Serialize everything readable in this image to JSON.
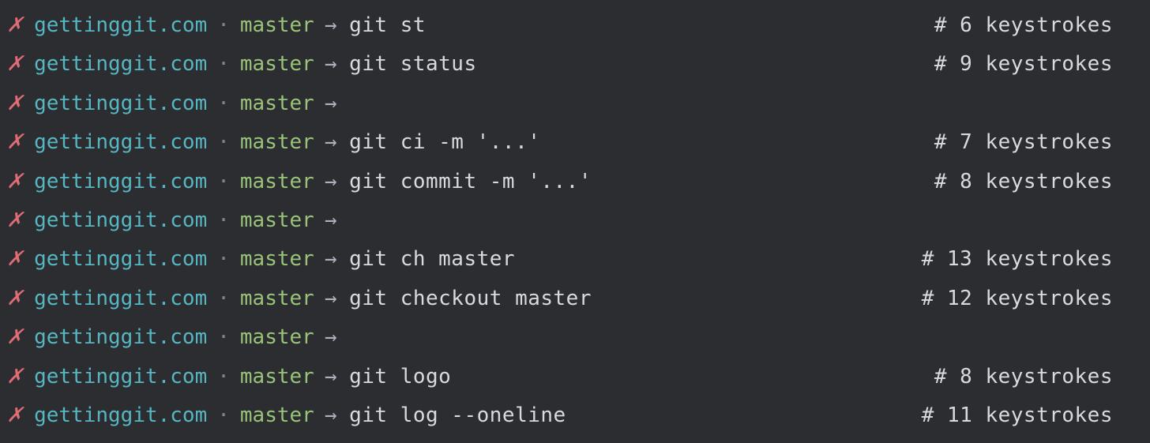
{
  "prompt": {
    "icon": "✗",
    "dir": "gettinggit.com",
    "sep": "·",
    "branch": "master",
    "arrow": "→"
  },
  "lines": [
    {
      "cmd": "git st",
      "comment": "# 6 keystrokes"
    },
    {
      "cmd": "git status",
      "comment": "# 9 keystrokes"
    },
    {
      "cmd": "",
      "comment": ""
    },
    {
      "cmd": "git ci -m '...'",
      "comment": "# 7 keystrokes"
    },
    {
      "cmd": "git commit -m '...'",
      "comment": "# 8 keystrokes"
    },
    {
      "cmd": "",
      "comment": ""
    },
    {
      "cmd": "git ch master",
      "comment": "# 13 keystrokes"
    },
    {
      "cmd": "git checkout master",
      "comment": "# 12 keystrokes"
    },
    {
      "cmd": "",
      "comment": ""
    },
    {
      "cmd": "git logo",
      "comment": "# 8 keystrokes"
    },
    {
      "cmd": "git log --oneline",
      "comment": "# 11 keystrokes"
    }
  ]
}
